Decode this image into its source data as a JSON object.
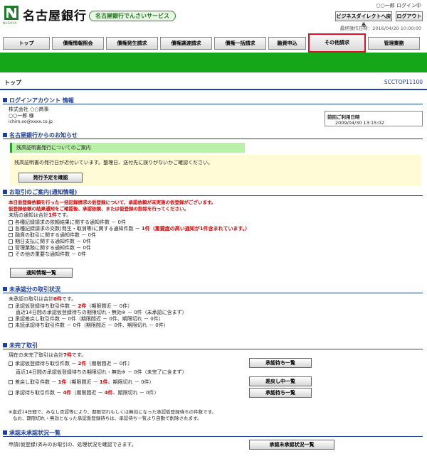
{
  "header": {
    "bank_name": "名古屋銀行",
    "logo_sub": "NAGOYA",
    "service_name": "名古屋銀行でんさいサービス",
    "login_user": "○○一郎 ログイン中",
    "bd_button": "ビジネスダイレクトへ戻る",
    "logout_button": "ログアウト",
    "last_op": "最終操作日時：2016/04/20 10:00:00"
  },
  "nav": {
    "tabs": [
      "トップ",
      "債権情報照会",
      "債権発生請求",
      "債権譲渡請求",
      "債権一括請求",
      "融資申込",
      "その他請求",
      "管理業務"
    ]
  },
  "page": {
    "title": "トップ",
    "screen_id": "SCCTOP11100"
  },
  "login_info": {
    "heading": "ログインアカウント 情報",
    "company": "株式会社 ○○商事",
    "user": "○○一郎 様",
    "email": "ichiro.oo@xxxx.co.jp",
    "last_use_label": "前回ご利用日時",
    "last_use_value": "2009/04/30 13:15:02"
  },
  "bank_notice": {
    "heading": "名古屋銀行からのお知らせ",
    "title": "残高証明書発行についてのご案内",
    "body": "残高証明書の発行日が近付いています。整理日、送付先に誤りがないかご確認ください。",
    "button": "発行予定を確認"
  },
  "notifications": {
    "heading": "お取引のご案内(通知情報)",
    "warn1": "本日仮登録依頼を行った一括記録請求の仮登録について、承認依頼が未実施の仮登録がございます。",
    "warn2": "仮登録依頼の結果通知をご確認後、承認依頼、または仮登録の削除を行ってください。",
    "summary_pre": "未読の通知は合計",
    "summary_count": "1件",
    "summary_post": "です。",
    "items": [
      {
        "label": "各種記録請求の依頼結果に関する通知件数 － 0件",
        "extra": ""
      },
      {
        "label": "各種記録請求の交数(発生・取消等)に関する通知件数 － ",
        "count": "1件",
        "extra": "（重要度の高い通知が1件含まれています。）"
      },
      {
        "label": "融資の取引に関する通知件数 － 0件",
        "extra": ""
      },
      {
        "label": "期日支払に関する通知件数 － 0件",
        "extra": ""
      },
      {
        "label": "管理業務に関する通知件数 － 0件",
        "extra": ""
      },
      {
        "label": "その他の重要な通知件数 － 0件",
        "extra": ""
      }
    ],
    "button": "通知情報一覧"
  },
  "unapproved": {
    "heading": "未承認分の取引状況",
    "summary_pre": "未承認の取引は合計",
    "summary_count": "0件",
    "summary_post": "です。",
    "line1_pre": "承認仮登録待ち取引件数 － ",
    "line1_count": "2件",
    "line1_post": "（期限間近 － 0件）",
    "line2": "直近14日間の承認仮登録待ちの期限切れ・無効※ － 0件（未承認に含まず）",
    "line3": "承認差戻し取引件数 － 0件（期限間近 － 0件、期限切れ － 0件）",
    "line4": "未読承認待ち取引件数 － 0件（期限間近 － 0件、期限切れ － 0件）"
  },
  "incomplete": {
    "heading": "未完了取引",
    "summary_pre": "現在の未完了取引は合計",
    "summary_count": "7件",
    "summary_post": "です。",
    "line1_pre": "承認仮登録待ち取引件数 － ",
    "line1_count": "2件",
    "line1_post": "（期限間近 － 0件）",
    "line2": "直近14日間の承認仮登録待ちの期限切れ・無効※ － 0件（未完了に含まず）",
    "line3_pre": "差戻し取引件数 － ",
    "line3_count": "1件",
    "line3_post": "（期限間近 － ",
    "line3_near": "1件",
    "line3_tail": "、期限切れ － 0件）",
    "line4_pre": "承認待ち取引件数 － ",
    "line4_count": "4件",
    "line4_post": "（期限間近 － ",
    "line4_near": "4件",
    "line4_tail": "、期限切れ － 0件）",
    "btn1": "承認待ち一覧",
    "btn2": "差戻し中一覧",
    "btn3": "承認待ち一覧",
    "note1": "※直近14日間で、みなし否認等により、期限切れもしくは無効になった承認仮登録待ちの件数です。",
    "note2": "なお、期限切れ・無効となった承認仮登録待ちは、承認待ち一覧より自動で削除されます。"
  },
  "approval_list": {
    "heading": "承認未承認状況一覧",
    "body": "申請(仮登録)済みのお取引の、処理状況を確認できます。",
    "button": "承認未承認状況一覧"
  }
}
